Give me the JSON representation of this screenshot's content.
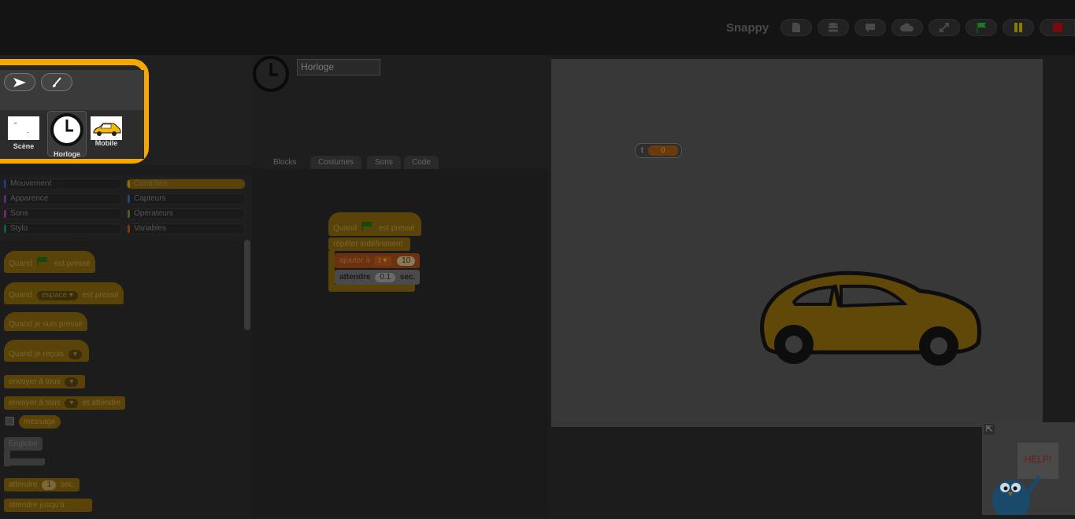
{
  "app": {
    "title": "Snappy"
  },
  "toolbar": {
    "icons": [
      "file-icon",
      "database-icon",
      "speech-bubble-icon",
      "cloud-icon",
      "fullscreen-icon",
      "green-flag-icon",
      "pause-icon",
      "stop-icon"
    ]
  },
  "corral": {
    "sprites": [
      {
        "label": "Scène"
      },
      {
        "label": "Horloge"
      },
      {
        "label": "Mobile"
      }
    ]
  },
  "sprite": {
    "name": "Horloge"
  },
  "tabs": [
    "Blocks",
    "Costumes",
    "Sons",
    "Code"
  ],
  "categories": [
    {
      "label": "Mouvement",
      "color": "#1f3a7a"
    },
    {
      "label": "Contrôles",
      "color": "#8a6a10"
    },
    {
      "label": "Apparence",
      "color": "#5a2a7a"
    },
    {
      "label": "Capteurs",
      "color": "#1a4a7a"
    },
    {
      "label": "Sons",
      "color": "#6a2a6a"
    },
    {
      "label": "Opérateurs",
      "color": "#3a6a1a"
    },
    {
      "label": "Stylo",
      "color": "#0a5a4a"
    },
    {
      "label": "Variables",
      "color": "#7a3a0a"
    }
  ],
  "palette": {
    "when_flag": [
      "Quand",
      "est pressé"
    ],
    "when_key": [
      "Quand",
      "espace",
      "est pressé"
    ],
    "when_clicked": "Quand je suis pressé",
    "when_receive": "Quand je reçois",
    "broadcast": "envoyer à tous",
    "broadcast_wait": [
      "envoyer à tous",
      "et attendre"
    ],
    "message": "message",
    "englobe": "Englobe",
    "wait": [
      "attendre",
      "1",
      "sec."
    ],
    "wait_until": "attendre jusqu'à"
  },
  "script": {
    "when_flag": [
      "Quand",
      "est pressé"
    ],
    "forever": "répéter indéfiniment",
    "change": [
      "ajouter à",
      "t",
      "10"
    ],
    "wait": [
      "attendre",
      "0.1",
      "sec."
    ]
  },
  "stage": {
    "watcher": {
      "name": "t",
      "value": "0"
    },
    "help": "HELP!"
  }
}
